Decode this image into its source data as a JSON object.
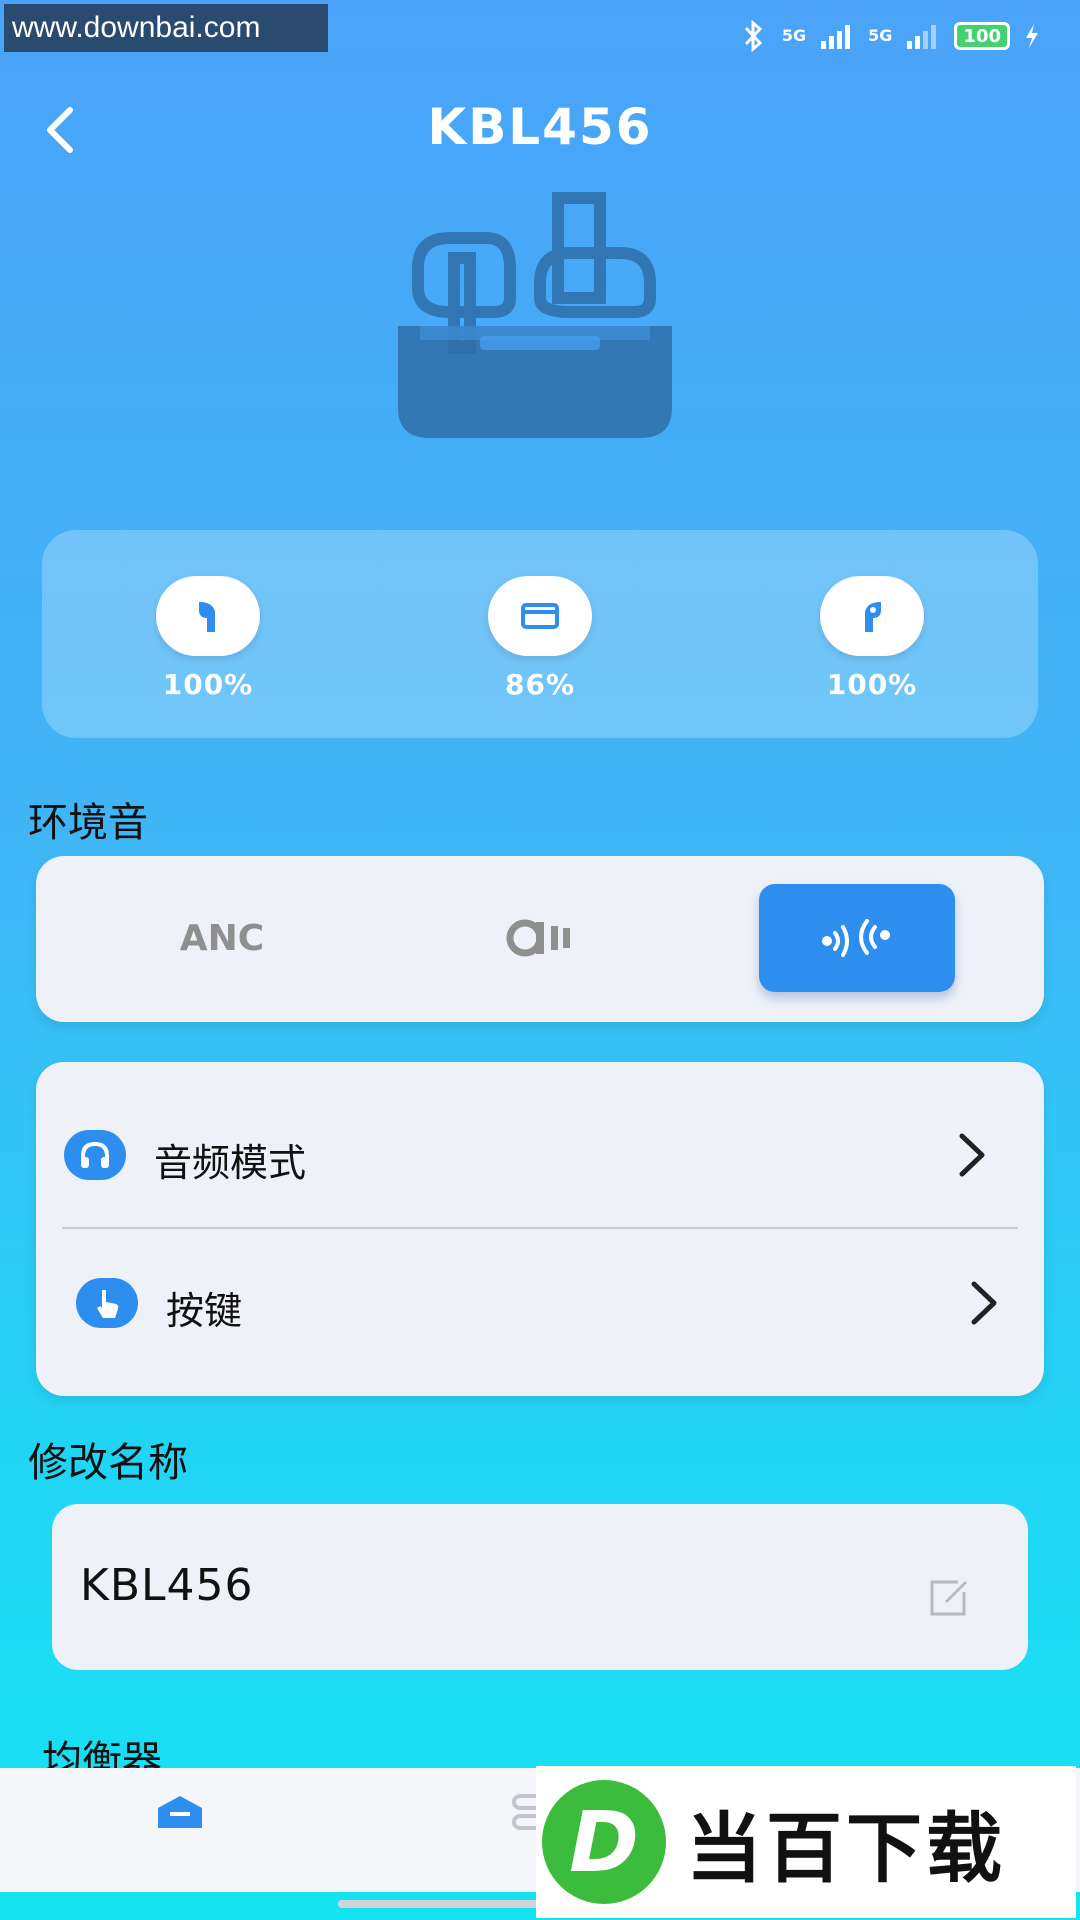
{
  "watermark": "www.downbai.com",
  "status_bar": {
    "signal_1": "5G",
    "signal_2": "5G",
    "battery": "100"
  },
  "header": {
    "title": "KBL456"
  },
  "battery": {
    "left": "100%",
    "case": "86%",
    "right": "100%"
  },
  "ambient": {
    "title": "环境音",
    "modes": {
      "anc_label": "ANC",
      "selected": "transparency"
    }
  },
  "menu": {
    "audio_mode": "音频模式",
    "keys": "按键"
  },
  "rename": {
    "title": "修改名称",
    "value": "KBL456"
  },
  "equalizer": {
    "title": "均衡器"
  },
  "branding": {
    "text": "当百下载",
    "letter": "D"
  },
  "colors": {
    "accent": "#2e8ef0",
    "background_top": "#4aa3f8",
    "background_bottom": "#14e4f2"
  }
}
